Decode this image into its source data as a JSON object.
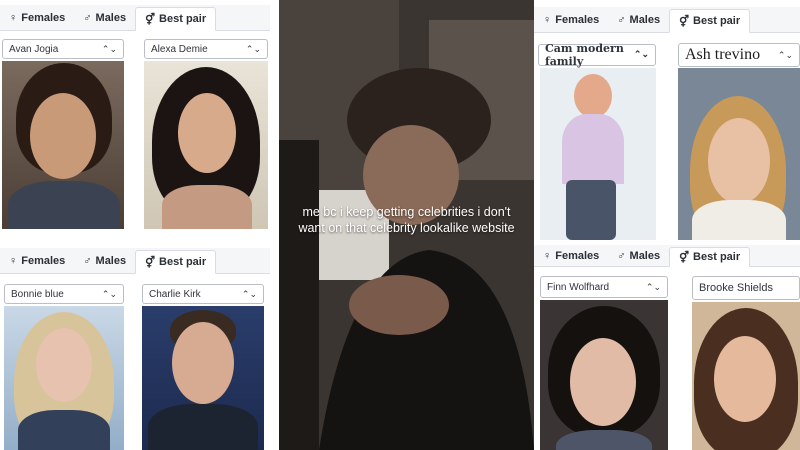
{
  "tabs": {
    "females": "Females",
    "males": "Males",
    "best_pair": "Best pair",
    "female_icon": "♀",
    "male_icon": "♂",
    "pair_icon": "⚥"
  },
  "panels": {
    "top_left": {
      "left_name": "Avan Jogia",
      "right_name": "Alexa Demie"
    },
    "bottom_left": {
      "left_name": "Bonnie blue",
      "right_name": "Charlie Kirk"
    },
    "top_right": {
      "left_name": "Cam modern family",
      "right_name": "Ash trevino"
    },
    "bottom_right": {
      "left_name": "Finn Wolfhard",
      "right_name": "Brooke Shields"
    }
  },
  "video": {
    "caption": "me bc i keep getting celebrities i don't want on that celebrity lookalike website"
  },
  "icons": {
    "chevron": "⌃⌄"
  }
}
